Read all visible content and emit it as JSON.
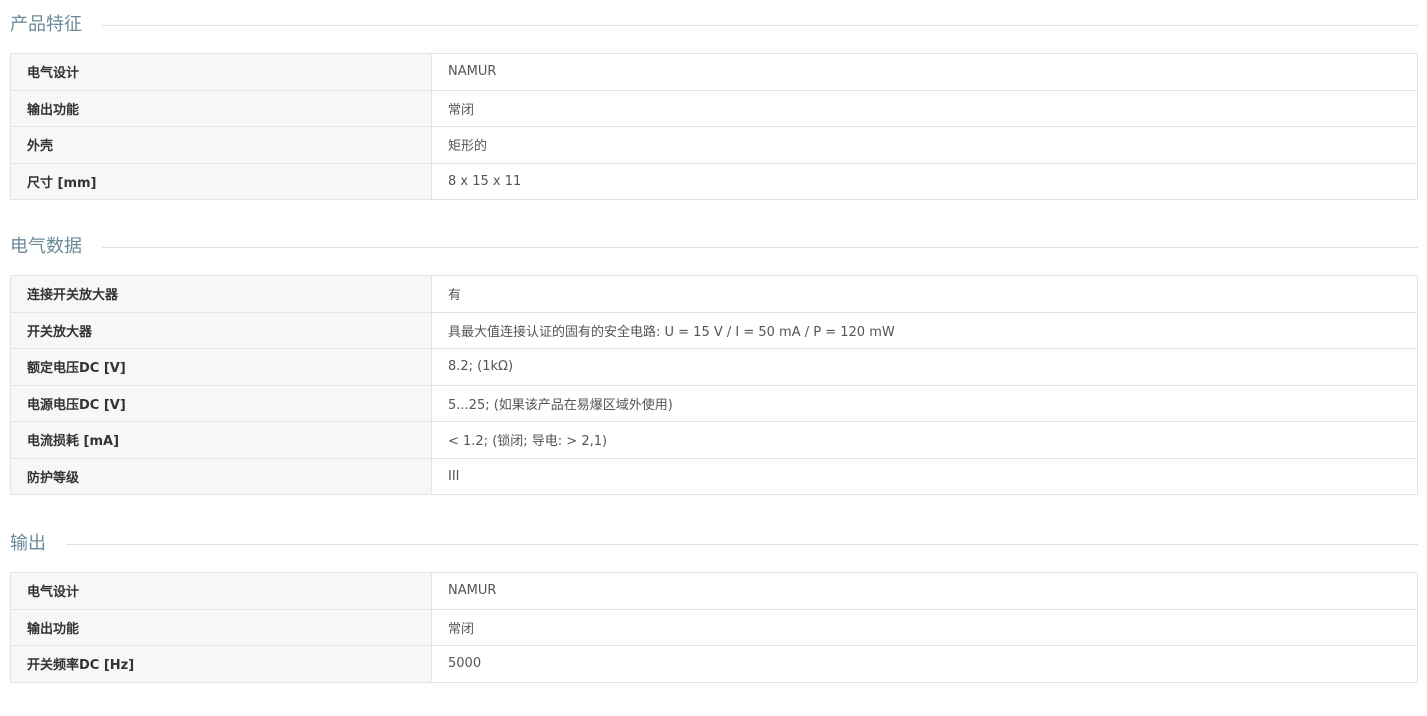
{
  "sections": [
    {
      "title": "产品特征",
      "rows": [
        {
          "label": "电气设计",
          "value": "NAMUR"
        },
        {
          "label": "输出功能",
          "value": "常闭"
        },
        {
          "label": "外壳",
          "value": "矩形的"
        },
        {
          "label": "尺寸 [mm]",
          "value": "8 x 15 x 11"
        }
      ]
    },
    {
      "title": "电气数据",
      "rows": [
        {
          "label": "连接开关放大器",
          "value": "有"
        },
        {
          "label": "开关放大器",
          "value": "具最大值连接认证的固有的安全电路: U = 15 V / I = 50 mA / P = 120 mW"
        },
        {
          "label": "额定电压DC [V]",
          "value": "8.2; (1kΩ)"
        },
        {
          "label": "电源电压DC [V]",
          "value": "5...25; (如果该产品在易爆区域外使用)"
        },
        {
          "label": "电流损耗 [mA]",
          "value": "< 1.2; (锁闭; 导电: > 2,1)"
        },
        {
          "label": "防护等级",
          "value": "III"
        }
      ]
    },
    {
      "title": "输出",
      "rows": [
        {
          "label": "电气设计",
          "value": "NAMUR"
        },
        {
          "label": "输出功能",
          "value": "常闭"
        },
        {
          "label": "开关频率DC [Hz]",
          "value": "5000"
        }
      ]
    }
  ]
}
